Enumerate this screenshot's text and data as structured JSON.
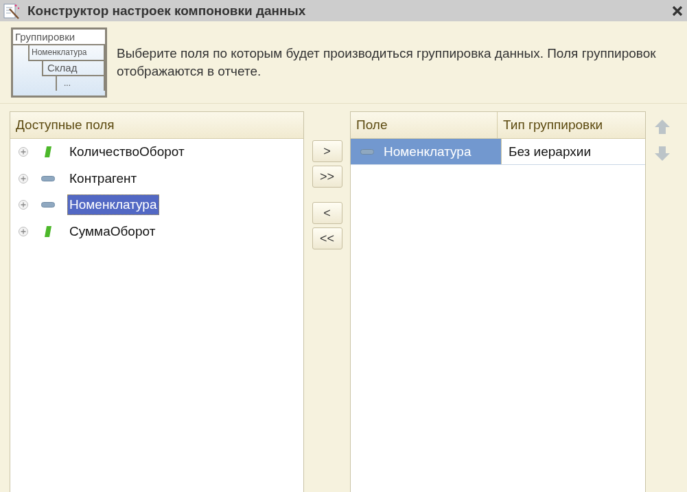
{
  "window": {
    "title": "Конструктор настроек компоновки данных"
  },
  "header": {
    "illustration_labels": [
      "Группировки",
      "Номенклатура",
      "Склад",
      "..."
    ],
    "description": "Выберите поля по которым будет производиться группировка данных. Поля группировок отображаются в отчете."
  },
  "available_fields": {
    "title": "Доступные поля",
    "items": [
      {
        "label": "КоличествоОборот",
        "kind": "resource",
        "selected": false
      },
      {
        "label": "Контрагент",
        "kind": "attribute",
        "selected": false
      },
      {
        "label": "Номенклатура",
        "kind": "attribute",
        "selected": true
      },
      {
        "label": "СуммаОборот",
        "kind": "resource",
        "selected": false
      }
    ]
  },
  "move_buttons": [
    ">",
    ">>",
    "<",
    "<<"
  ],
  "grouping_table": {
    "columns": [
      "Поле",
      "Тип группировки"
    ],
    "rows": [
      {
        "field": "Номенклатура",
        "kind": "attribute",
        "grouping_type": "Без иерархии",
        "selected": true
      }
    ]
  }
}
